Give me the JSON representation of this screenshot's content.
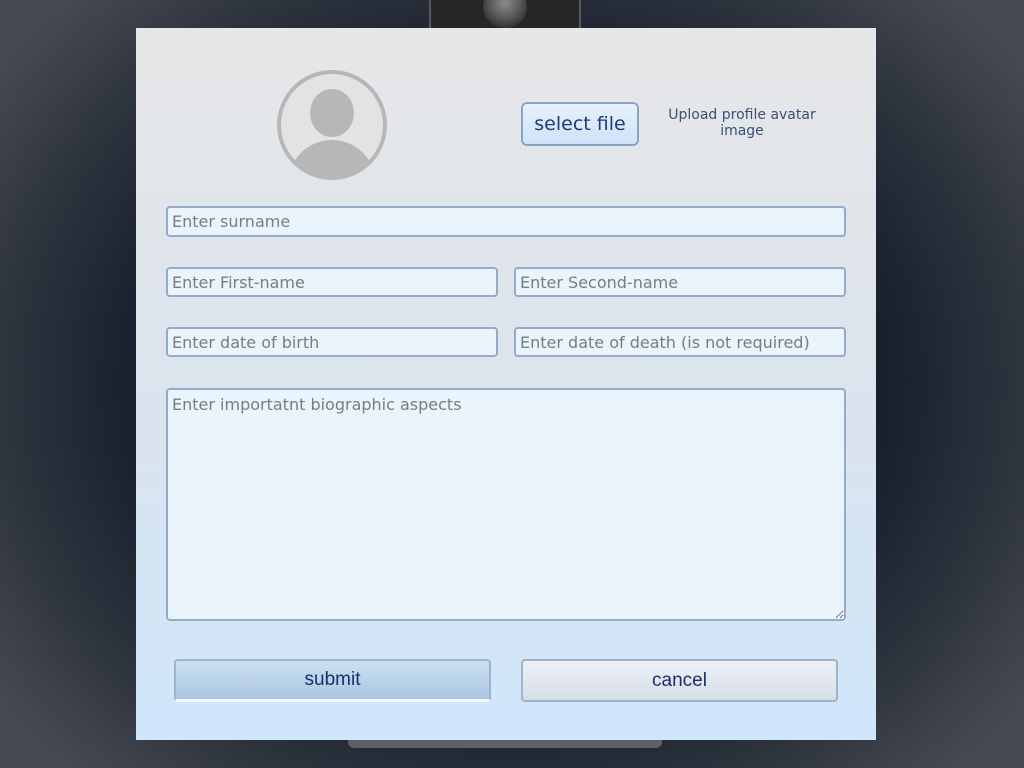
{
  "modal": {
    "upload": {
      "button_label": "select file",
      "hint": "Upload profile avatar image"
    },
    "fields": {
      "surname_placeholder": "Enter surname",
      "first_name_placeholder": "Enter First-name",
      "second_name_placeholder": "Enter Second-name",
      "birth_placeholder": "Enter date of birth",
      "death_placeholder": "Enter date of death (is not required)",
      "bio_placeholder": "Enter importatnt biographic aspects"
    },
    "actions": {
      "submit_label": "submit",
      "cancel_label": "cancel"
    }
  },
  "icons": {
    "avatar": "default-user-avatar-icon"
  },
  "colors": {
    "button_text": "#1c3d75",
    "field_border": "#93abc8",
    "field_background": "#eaf4fc",
    "avatar_gray": "#b7b7b7"
  }
}
